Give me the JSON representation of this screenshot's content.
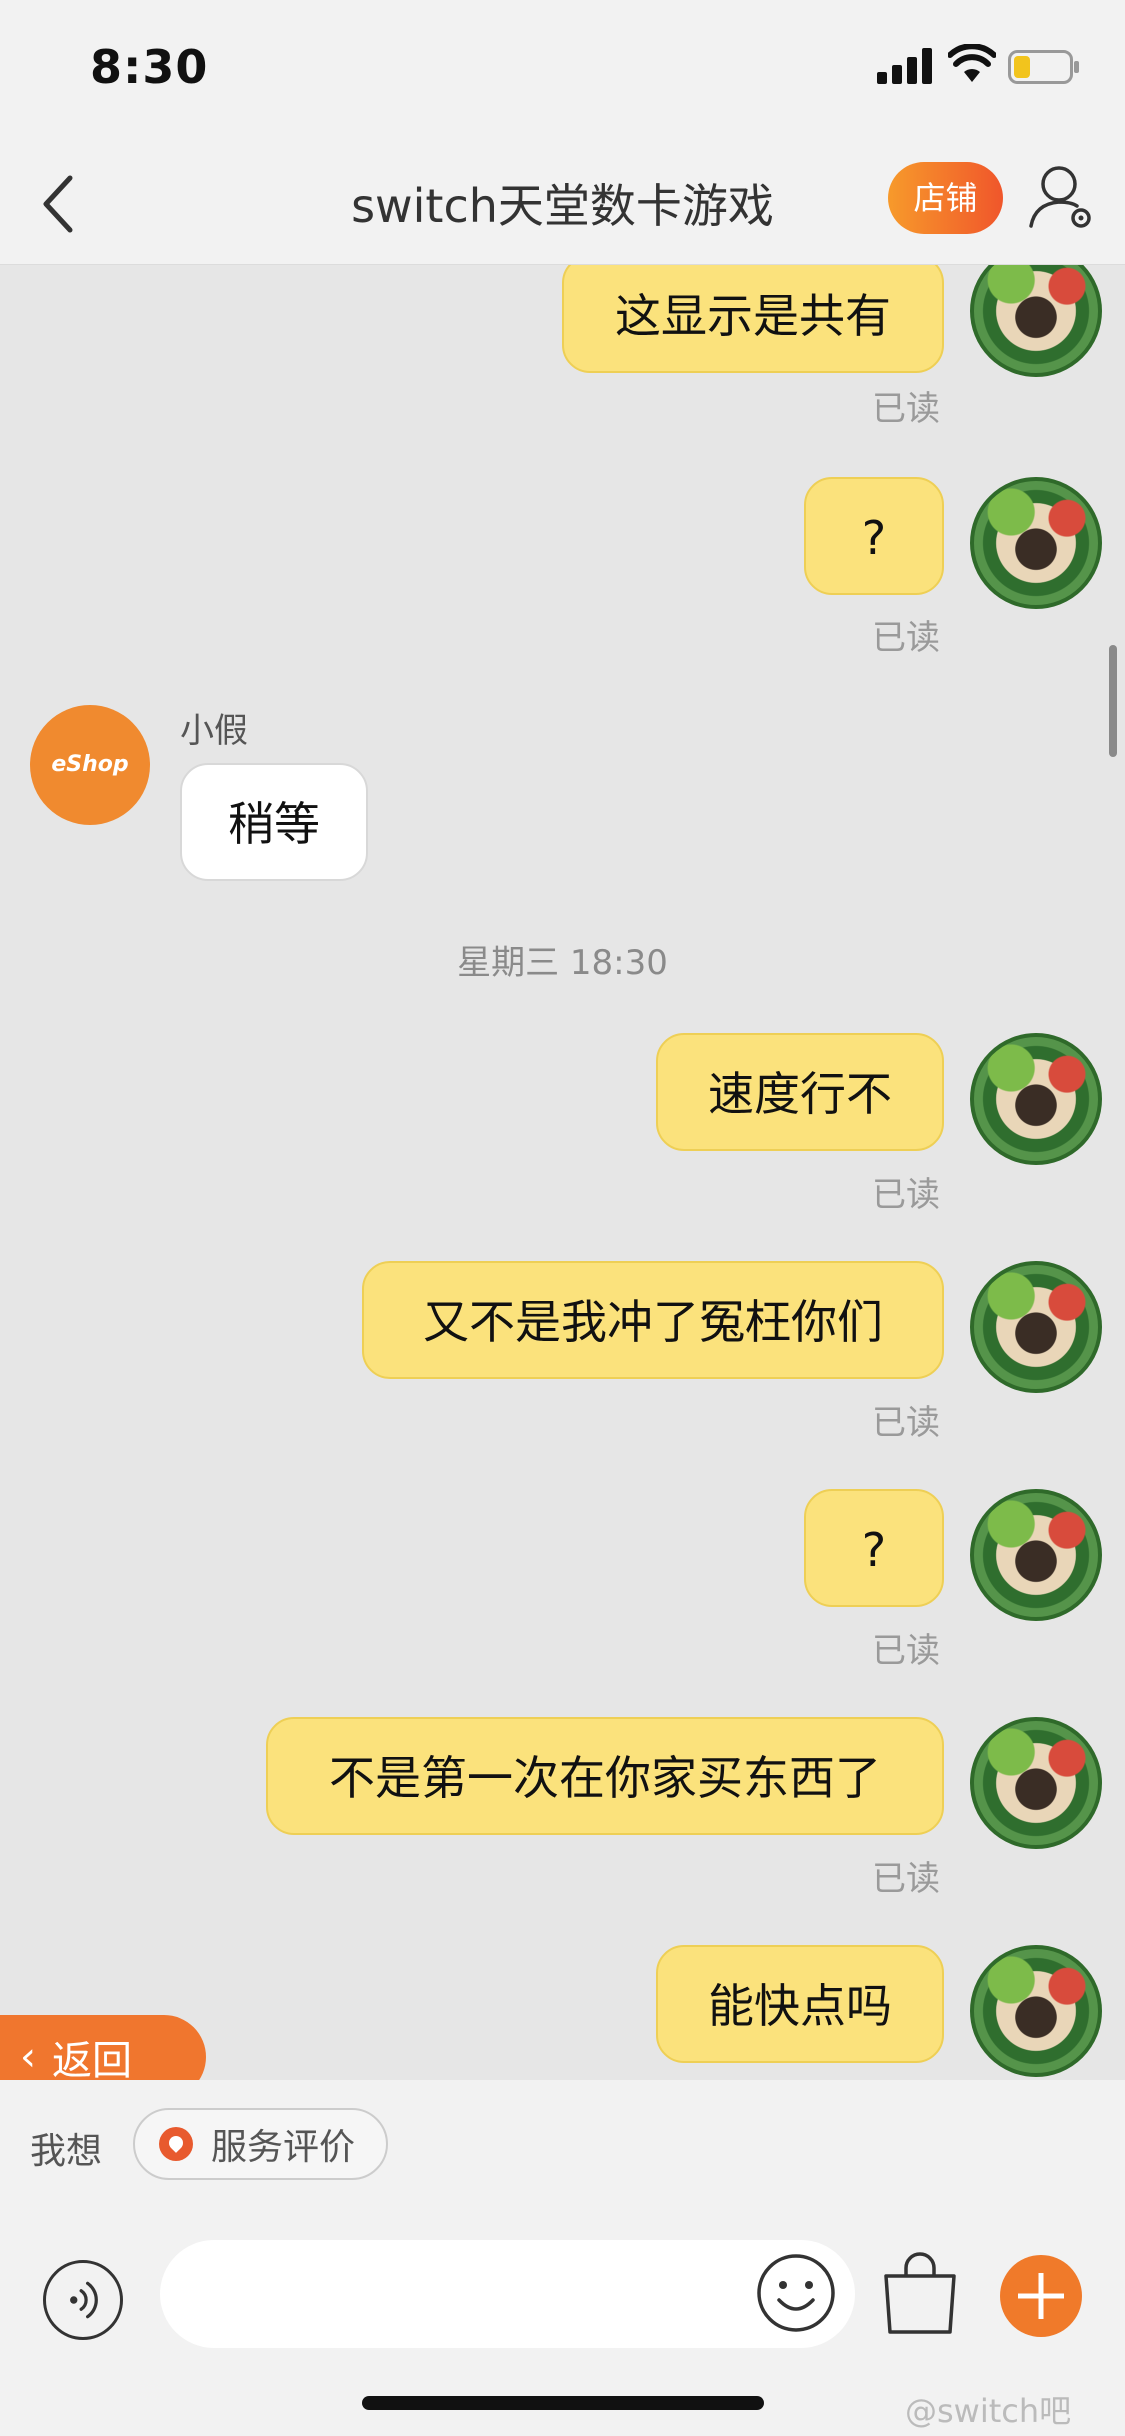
{
  "status_bar": {
    "time": "8:30"
  },
  "nav": {
    "title": "switch天堂数卡游戏",
    "store_label": "店铺"
  },
  "messages": [
    {
      "from": "me",
      "text": "这显示是共有",
      "status": "已读"
    },
    {
      "from": "me",
      "text": "?",
      "status": "已读"
    },
    {
      "from": "shop",
      "sender": "小假",
      "avatar_text": "eShop",
      "text": "稍等"
    },
    {
      "timestamp": "星期三 18:30"
    },
    {
      "from": "me",
      "text": "速度行不",
      "status": "已读"
    },
    {
      "from": "me",
      "text": "又不是我冲了冤枉你们",
      "status": "已读"
    },
    {
      "from": "me",
      "text": "?",
      "status": "已读"
    },
    {
      "from": "me",
      "text": "不是第一次在你家买东西了",
      "status": "已读"
    },
    {
      "from": "me",
      "text": "能快点吗"
    }
  ],
  "return_button": {
    "label": "返回"
  },
  "quick_bar": {
    "label": "我想",
    "review_chip": "服务评价"
  },
  "watermark": "@switch吧",
  "colors": {
    "accent": "#f07a2a",
    "my_bubble": "#fbe27c",
    "background": "#e6e6e6"
  }
}
